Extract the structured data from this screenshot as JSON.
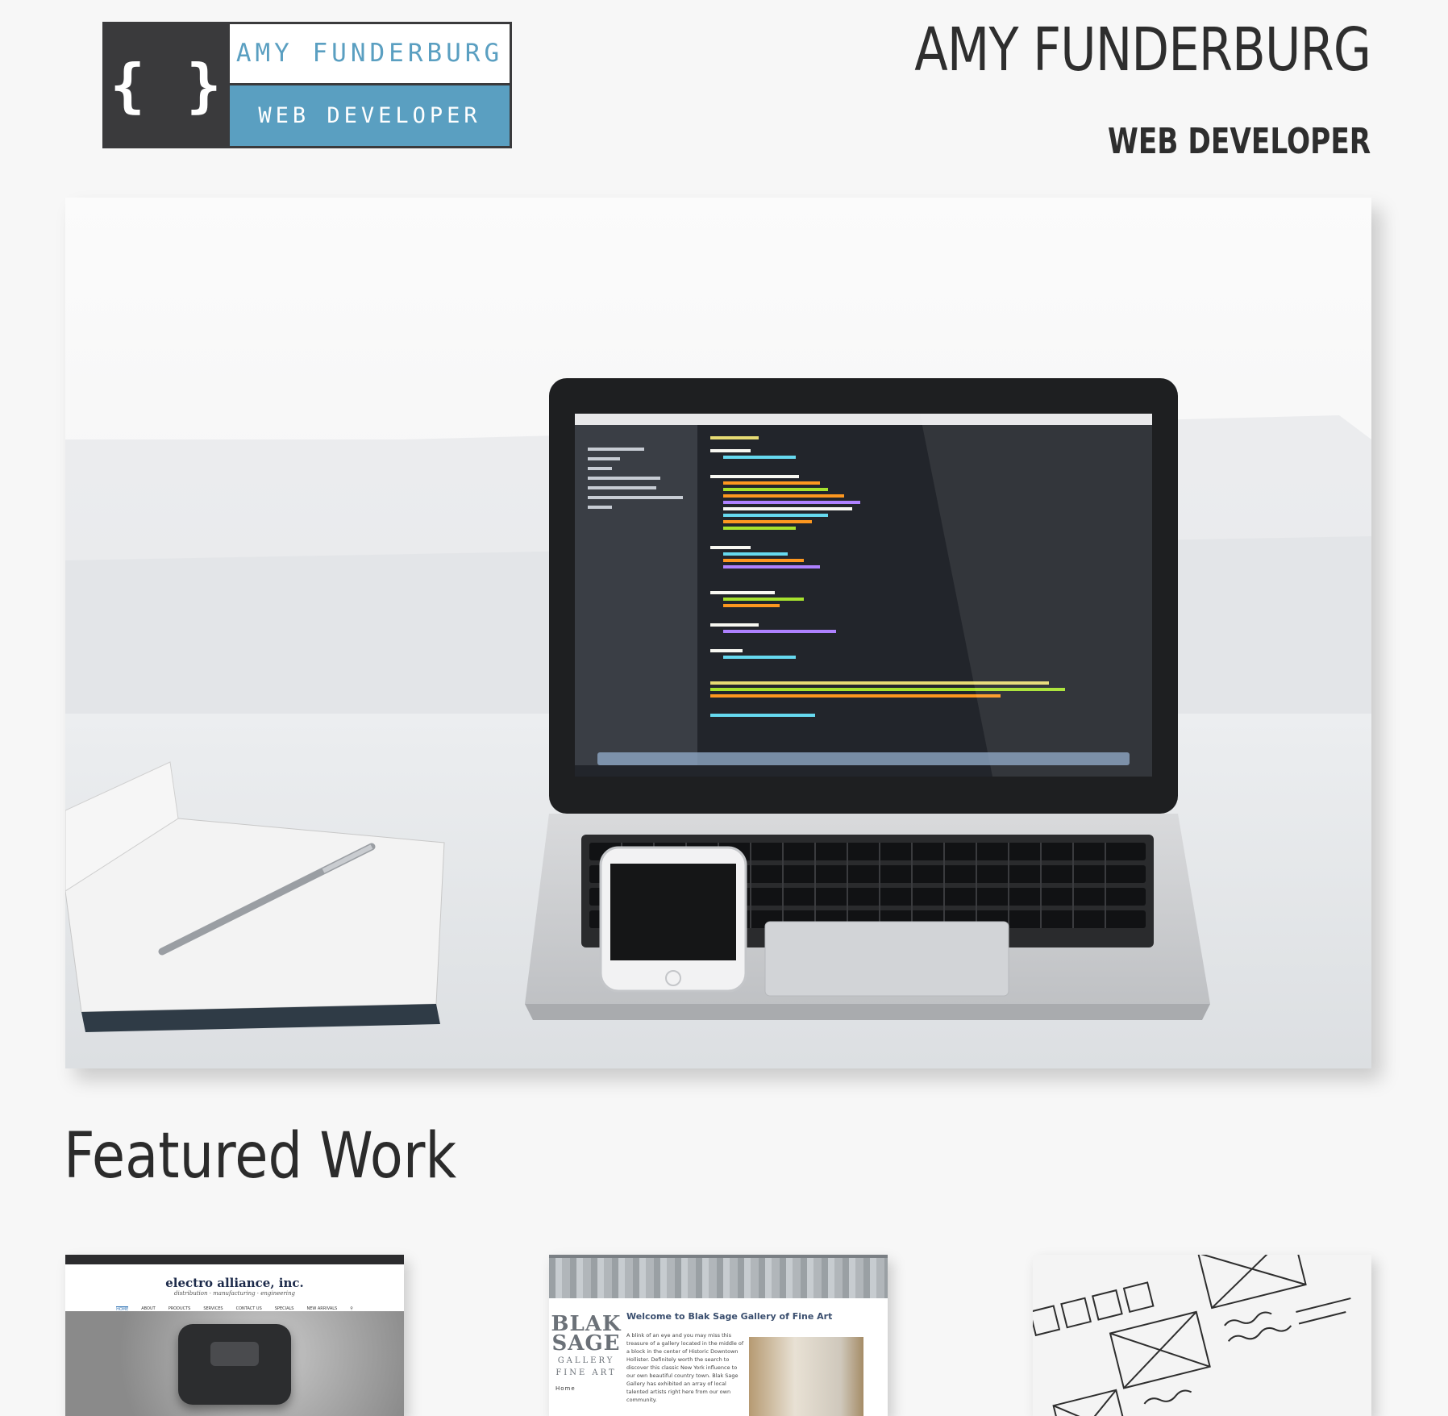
{
  "logo": {
    "mark": "{ }",
    "name": "AMY FUNDERBURG",
    "title": "WEB DEVELOPER",
    "colors": {
      "dark": "#3a3a3c",
      "accent": "#5a9fc1"
    }
  },
  "header": {
    "title": "AMY FUNDERBURG",
    "subtitle": "WEB DEVELOPER"
  },
  "hero": {
    "image": "laptop-notebook-phone-photo"
  },
  "featured": {
    "heading": "Featured Work",
    "cards": [
      {
        "image": "electro-alliance-site-screenshot",
        "brand": "electro alliance, inc.",
        "tagline": "distribution · manufacturing · engineering",
        "nav": [
          "HOME",
          "ABOUT",
          "PRODUCTS",
          "SERVICES",
          "CONTACT US",
          "SPECIALS",
          "NEW ARRIVALS"
        ]
      },
      {
        "image": "blak-sage-gallery-site-screenshot",
        "logo_line1": "BLAK SAGE",
        "logo_line2": "GALLERY",
        "logo_line3": "FINE ART",
        "nav_item": "Home",
        "heading": "Welcome to Blak Sage Gallery of Fine Art",
        "body": "A blink of an eye and you may miss this treasure of a gallery located in the middle of a block in the center of Historic Downtown Hollister. Definitely worth the search to discover this classic New York influence to our own beautiful country town. Blak Sage Gallery has exhibited an array of local talented artists right here from our own community."
      },
      {
        "image": "wireframe-sketch-photo"
      }
    ]
  }
}
